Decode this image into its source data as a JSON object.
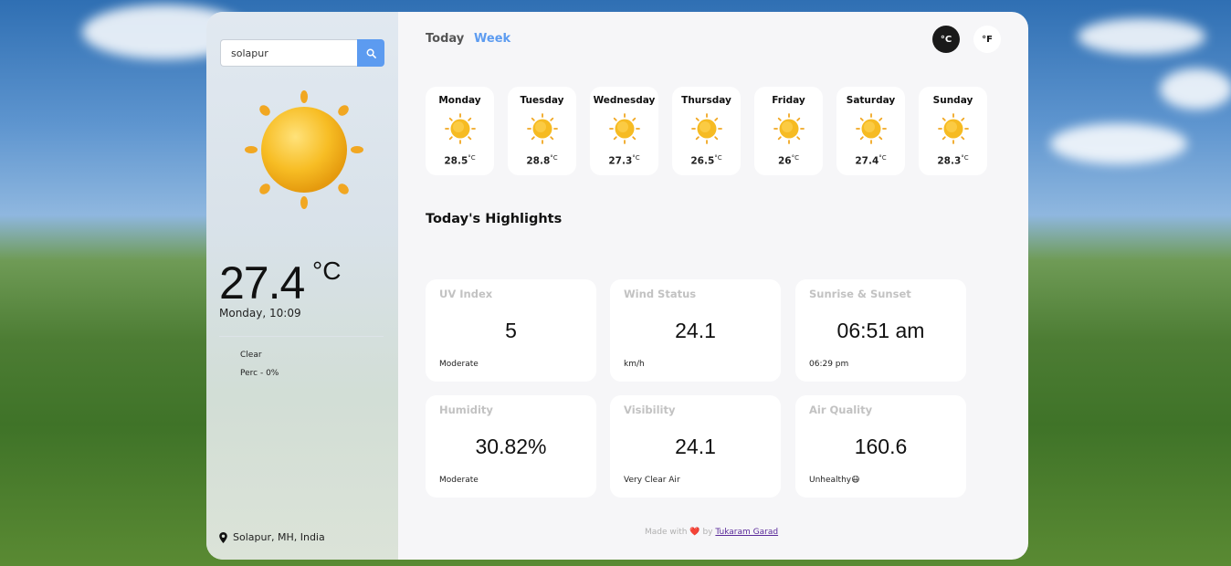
{
  "search": {
    "value": "solapur"
  },
  "current": {
    "temp": "27.4",
    "unit": "°C",
    "datetime": "Monday, 10:09",
    "condition": "Clear",
    "precipitation": "Perc - 0%",
    "location": "Solapur, MH, India"
  },
  "tabs": {
    "today": "Today",
    "week": "Week"
  },
  "units": {
    "celsius": "°C",
    "fahrenheit": "°F"
  },
  "week": [
    {
      "day": "Monday",
      "temp": "28.5",
      "unit": "°C"
    },
    {
      "day": "Tuesday",
      "temp": "28.8",
      "unit": "°C"
    },
    {
      "day": "Wednesday",
      "temp": "27.3",
      "unit": "°C"
    },
    {
      "day": "Thursday",
      "temp": "26.5",
      "unit": "°C"
    },
    {
      "day": "Friday",
      "temp": "26",
      "unit": "°C"
    },
    {
      "day": "Saturday",
      "temp": "27.4",
      "unit": "°C"
    },
    {
      "day": "Sunday",
      "temp": "28.3",
      "unit": "°C"
    }
  ],
  "highlights": {
    "title": "Today's Highlights",
    "uv": {
      "label": "UV Index",
      "value": "5",
      "sub": "Moderate"
    },
    "wind": {
      "label": "Wind Status",
      "value": "24.1",
      "sub": "km/h"
    },
    "sun": {
      "label": "Sunrise & Sunset",
      "value": "06:51 am",
      "sub": "06:29 pm"
    },
    "humidity": {
      "label": "Humidity",
      "value": "30.82%",
      "sub": "Moderate"
    },
    "visibility": {
      "label": "Visibility",
      "value": "24.1",
      "sub": "Very Clear Air"
    },
    "air": {
      "label": "Air Quality",
      "value": "160.6",
      "sub": "Unhealthy😷"
    }
  },
  "footer": {
    "made_with": "Made with",
    "heart": "❤️",
    "by": "by",
    "author": "Tukaram Garad"
  },
  "colors": {
    "accent": "#5c9bf0",
    "sun": "#f5b820",
    "panel": "#f6f6f8"
  }
}
